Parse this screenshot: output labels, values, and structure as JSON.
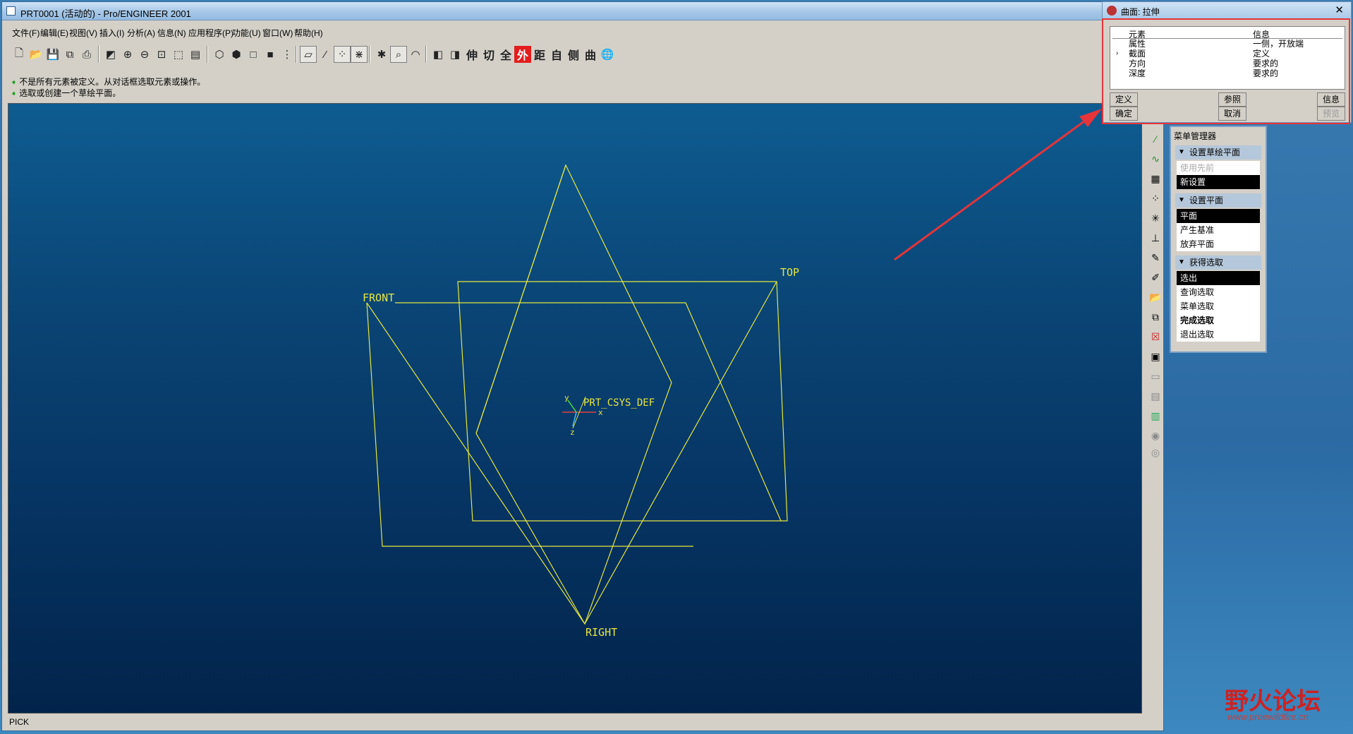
{
  "window": {
    "title": "PRT0001 (活动的) - Pro/ENGINEER 2001"
  },
  "menu": [
    "文件(F)",
    "编辑(E)",
    "视图(V)",
    "插入(I)",
    "分析(A)",
    "信息(N)",
    "应用程序(P)",
    "功能(U)",
    "窗口(W)",
    "帮助(H)"
  ],
  "toolbar_text": {
    "t1": "伸",
    "t2": "切",
    "t3": "全",
    "t4": "外",
    "t5": "距",
    "t6": "自",
    "t7": "侧",
    "t8": "曲"
  },
  "messages": {
    "line1": "不是所有元素被定义。从对话框选取元素或操作。",
    "line2": "选取或创建一个草绘平面。"
  },
  "viewport": {
    "labels": {
      "front": "FRONT",
      "top": "TOP",
      "right": "RIGHT",
      "csys": "PRT_CSYS_DEF",
      "x": "x",
      "y": "y",
      "z": "z"
    },
    "plane_color": "#e6e640",
    "axis_x_color": "#e04040",
    "axis_y_color": "#40e040",
    "axis_z_color": "#40c0ff"
  },
  "status": {
    "text": "PICK"
  },
  "dialog": {
    "title": "曲面: 拉伸",
    "columns": [
      "元素",
      "信息"
    ],
    "rows": [
      {
        "element": "属性",
        "info": "一侧，开放端"
      },
      {
        "element": "截面",
        "info": "定义"
      },
      {
        "element": "方向",
        "info": "要求的"
      },
      {
        "element": "深度",
        "info": "要求的"
      }
    ],
    "buttons": {
      "define": "定义",
      "reference": "参照",
      "info": "信息",
      "ok": "确定",
      "cancel": "取消",
      "preview": "预览"
    }
  },
  "menu_manager": {
    "title": "菜单管理器",
    "sections": {
      "s1": {
        "header": "设置草绘平面",
        "items": [
          "使用先前",
          "新设置"
        ]
      },
      "s2": {
        "header": "设置平面",
        "items": [
          "平面",
          "产生基准",
          "放弃平面"
        ]
      },
      "s3": {
        "header": "获得选取",
        "items": [
          "选出",
          "查询选取",
          "菜单选取",
          "完成选取",
          "退出选取"
        ]
      }
    }
  },
  "watermark": {
    "logo": "野火论坛",
    "url": "www.proewildfire.cn"
  },
  "colors": {
    "annotation_arrow": "#e5343a",
    "selected_menu_bg": "#000000"
  }
}
